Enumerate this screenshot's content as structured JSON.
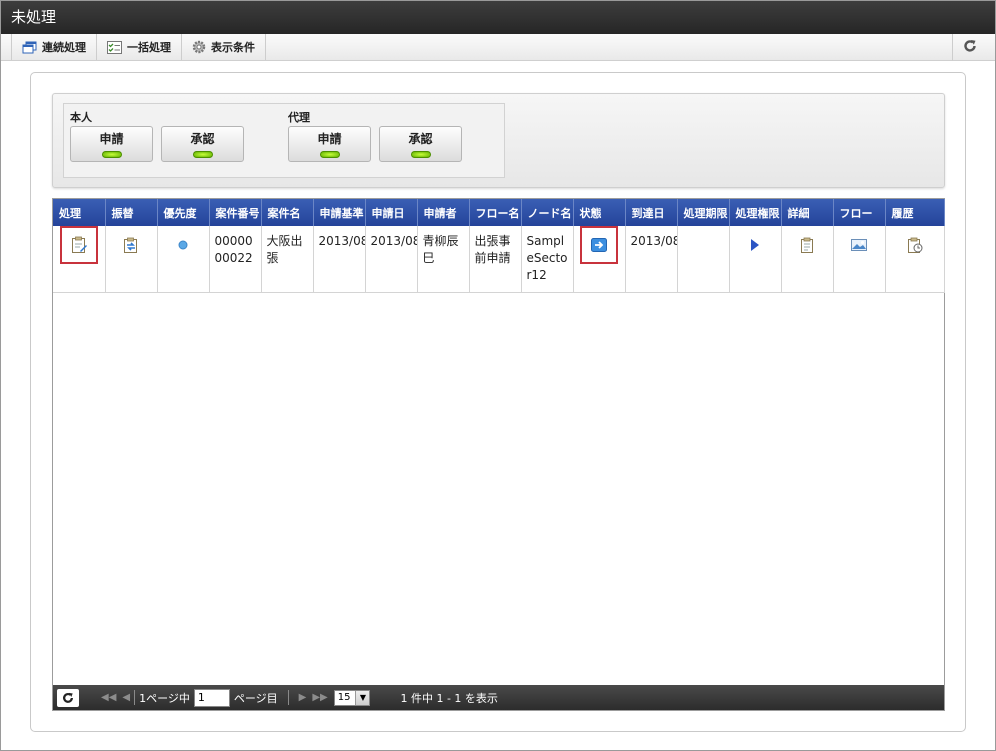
{
  "window": {
    "title": "未処理"
  },
  "toolbar": {
    "items": [
      {
        "label": "連続処理",
        "icon": "window-stack-icon"
      },
      {
        "label": "一括処理",
        "icon": "checklist-icon"
      },
      {
        "label": "表示条件",
        "icon": "gear-icon"
      }
    ],
    "refresh_icon": "refresh-icon"
  },
  "filters": {
    "self": {
      "label": "本人",
      "apply": "申請",
      "approve": "承認"
    },
    "proxy": {
      "label": "代理",
      "apply": "申請",
      "approve": "承認"
    }
  },
  "grid": {
    "columns": [
      "処理",
      "振替",
      "優先度",
      "案件番号",
      "案件名",
      "申請基準日",
      "申請日",
      "申請者",
      "フロー名",
      "ノード名",
      "状態",
      "到達日",
      "処理期限",
      "処理権限",
      "詳細",
      "フロー",
      "履歴"
    ],
    "rows": [
      {
        "process_icon": "clipboard-edit-icon",
        "transfer_icon": "transfer-icon",
        "priority_icon": "priority-dot-icon",
        "case_number": "0000000022",
        "case_name": "大阪出張",
        "base_date": "2013/08",
        "apply_date": "2013/08",
        "applicant": "青柳辰巳",
        "flow_name": "出張事前申請",
        "node_name": "SampleSector12",
        "status_icon": "status-arrow-icon",
        "arrival_date": "2013/08",
        "deadline": "",
        "authority_icon": "play-icon",
        "detail_icon": "clipboard-icon",
        "flow_icon": "flow-image-icon",
        "history_icon": "history-clock-icon"
      }
    ]
  },
  "pager": {
    "page_prefix": "1ページ中",
    "page_value": "1",
    "page_suffix": "ページ目",
    "per_page": "15",
    "summary": "1 件中 1 - 1 を表示"
  }
}
